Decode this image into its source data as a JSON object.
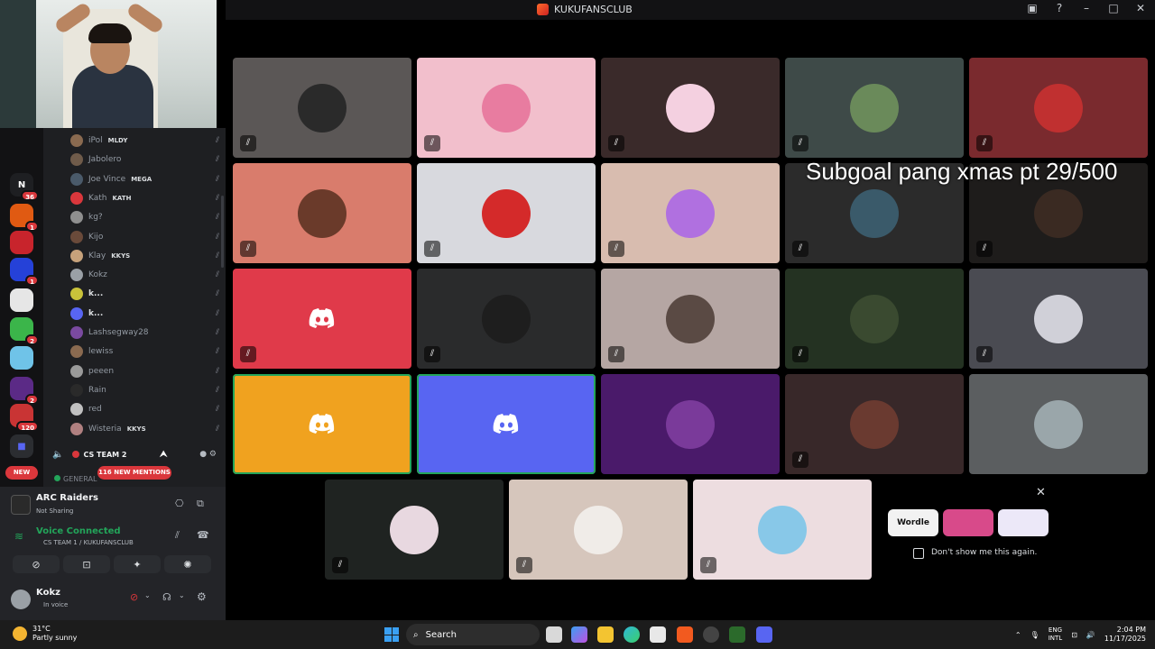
{
  "window": {
    "title": "KUKUFANSCLUB"
  },
  "rail": {
    "servers": [
      {
        "letter": "N",
        "badge": "36",
        "color": "#1e1f22"
      },
      {
        "letter": "",
        "badge": "1",
        "color": "#e05a12"
      },
      {
        "letter": "",
        "badge": "",
        "color": "#c8242c"
      },
      {
        "letter": "",
        "badge": "1",
        "color": "#2541d8"
      },
      {
        "letter": "",
        "badge": "",
        "color": "#e6e6e6"
      },
      {
        "letter": "",
        "badge": "2",
        "color": "#3bb54a"
      },
      {
        "letter": "",
        "badge": "",
        "color": "#6fc3e8"
      },
      {
        "letter": "",
        "badge": "2",
        "color": "#5b2a86"
      },
      {
        "letter": "",
        "badge": "120",
        "color": "#c93434"
      }
    ],
    "new_label": "NEW"
  },
  "members": [
    {
      "name": "iPol",
      "tag": "MLDY",
      "bright": false,
      "color": "#8a6a50"
    },
    {
      "name": "Jabolero",
      "tag": "",
      "bright": false,
      "color": "#6f5b4a"
    },
    {
      "name": "Joe Vince",
      "tag": "MEGA",
      "bright": false,
      "color": "#4a5a6a"
    },
    {
      "name": "Kath",
      "tag": "KATH",
      "bright": false,
      "color": "#da373c"
    },
    {
      "name": "kg?",
      "tag": "",
      "bright": false,
      "color": "#8f8f8f"
    },
    {
      "name": "Kijo",
      "tag": "",
      "bright": false,
      "color": "#6a4a3a"
    },
    {
      "name": "Klay",
      "tag": "KKYS",
      "bright": false,
      "color": "#c7a27b"
    },
    {
      "name": "Kokz",
      "tag": "",
      "bright": false,
      "color": "#9aa0a6"
    },
    {
      "name": "k...",
      "tag": "",
      "bright": true,
      "color": "#c9c23a"
    },
    {
      "name": "k...",
      "tag": "",
      "bright": true,
      "color": "#5865f2"
    },
    {
      "name": "Lashsegway28",
      "tag": "",
      "bright": false,
      "color": "#7a4aa0"
    },
    {
      "name": "lewiss",
      "tag": "",
      "bright": false,
      "color": "#8a6a50"
    },
    {
      "name": "peeen",
      "tag": "",
      "bright": false,
      "color": "#9a9a9a"
    },
    {
      "name": "Rain",
      "tag": "",
      "bright": false,
      "color": "#2a2a2a"
    },
    {
      "name": "red",
      "tag": "",
      "bright": false,
      "color": "#c0c0c0"
    },
    {
      "name": "Wisteria",
      "tag": "KKYS",
      "bright": false,
      "color": "#b08080"
    }
  ],
  "channel": {
    "name": "CS TEAM 2",
    "mentions": "116 NEW MENTIONS",
    "general": "GENERAL"
  },
  "panel": {
    "game_title": "ARC Raiders",
    "game_sub": "Not Sharing",
    "voice_title": "Voice Connected",
    "voice_sub": "CS TEAM 1 / KUKUFANSCLUB",
    "user_name": "Kokz",
    "user_status": "In voice"
  },
  "overlay_text": "Subgoal pang xmas pt  29/500",
  "tiles": [
    {
      "bg": "#5b5756",
      "avatar": "#2a2a2a",
      "type": "avatar",
      "muted": true
    },
    {
      "bg": "#f2bfcc",
      "avatar": "#e87ca0",
      "type": "avatar",
      "muted": true
    },
    {
      "bg": "#3a2a2a",
      "avatar": "#f4d0e0",
      "type": "avatar",
      "muted": true
    },
    {
      "bg": "#3e4a48",
      "avatar": "#6a8a5a",
      "type": "avatar",
      "muted": true
    },
    {
      "bg": "#7a2a2e",
      "avatar": "#c03030",
      "type": "avatar",
      "muted": true
    },
    {
      "bg": "#d97c6c",
      "avatar": "#6a3a2a",
      "type": "avatar",
      "muted": true
    },
    {
      "bg": "#d8d9de",
      "avatar": "#d42a2a",
      "type": "avatar",
      "muted": true
    },
    {
      "bg": "#d8bcaf",
      "avatar": "#b070e0",
      "type": "avatar",
      "muted": true
    },
    {
      "bg": "#2b2b2b",
      "avatar": "#3a5a6a",
      "type": "avatar",
      "muted": true
    },
    {
      "bg": "#1e1c1b",
      "avatar": "#3a2a22",
      "type": "avatar",
      "muted": true
    },
    {
      "bg": "#e03a4a",
      "avatar": "",
      "type": "logo",
      "muted": true
    },
    {
      "bg": "#2a2b2c",
      "avatar": "#1e1e1e",
      "type": "avatar",
      "muted": true
    },
    {
      "bg": "#b5a6a3",
      "avatar": "#5a4a44",
      "type": "avatar",
      "muted": true
    },
    {
      "bg": "#243222",
      "avatar": "#3a4a30",
      "type": "avatar",
      "muted": true
    },
    {
      "bg": "#4a4b52",
      "avatar": "#d0d0d8",
      "type": "avatar",
      "muted": true
    },
    {
      "bg": "#f0a21f",
      "avatar": "",
      "type": "logo",
      "muted": false,
      "speaking": true
    },
    {
      "bg": "#5865f2",
      "avatar": "",
      "type": "logo",
      "muted": false,
      "speaking": true
    },
    {
      "bg": "#4a1a6a",
      "avatar": "#7a3a9a",
      "type": "avatar",
      "muted": false
    },
    {
      "bg": "#382829",
      "avatar": "#6a3a30",
      "type": "avatar",
      "muted": true
    },
    {
      "bg": "#5b5e60",
      "avatar": "#9aa6aa",
      "type": "avatar",
      "muted": false
    },
    {
      "bg": "#1f2321",
      "avatar": "#e8d8e0",
      "type": "avatar",
      "muted": true
    },
    {
      "bg": "#d6c6bc",
      "avatar": "#f0ece8",
      "type": "avatar",
      "muted": true
    },
    {
      "bg": "#eddde0",
      "avatar": "#88c8e8",
      "type": "avatar",
      "muted": true
    }
  ],
  "activities": {
    "cards": [
      {
        "label": "Wordle",
        "color": "#f2f2f2"
      },
      {
        "label": "",
        "color": "#d84a8a"
      },
      {
        "label": "",
        "color": "#ece8f8"
      }
    ],
    "dont_show": "Don't show me this again."
  },
  "taskbar": {
    "temp": "31°C",
    "weather": "Partly sunny",
    "search_placeholder": "Search",
    "lang_1": "ENG",
    "lang_2": "INTL",
    "time": "2:04 PM",
    "date": "11/17/2025"
  }
}
